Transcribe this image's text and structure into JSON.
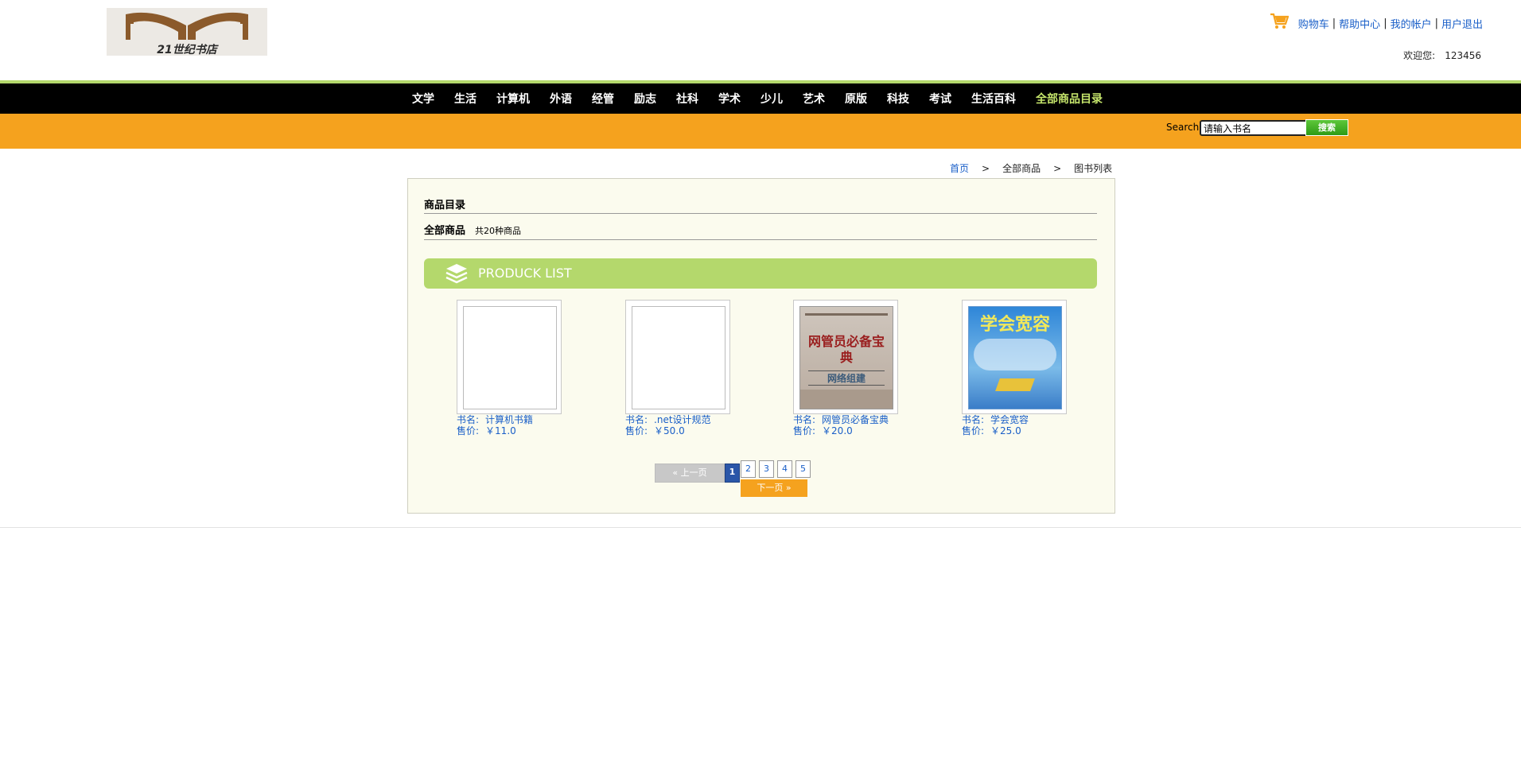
{
  "logo": {
    "text": "21世纪书店"
  },
  "toplinks": {
    "icon": "cart-icon",
    "items": [
      "购物车",
      "帮助中心",
      "我的帐户",
      "用户退出"
    ],
    "separator": "|"
  },
  "welcome": {
    "label": "欢迎您:",
    "user": "123456"
  },
  "nav": {
    "items": [
      "文学",
      "生活",
      "计算机",
      "外语",
      "经管",
      "励志",
      "社科",
      "学术",
      "少儿",
      "艺术",
      "原版",
      "科技",
      "考试",
      "生活百科",
      "全部商品目录"
    ]
  },
  "search": {
    "label": "Search",
    "value": "请输入书名",
    "button": "搜索"
  },
  "breadcrumb": {
    "home": "首页",
    "sep": ">",
    "level2": "全部商品",
    "level3": "图书列表"
  },
  "panel": {
    "title": "商品目录",
    "category": "全部商品",
    "count": "共20种商品",
    "banner": "PRODUCK LIST"
  },
  "products": [
    {
      "name_label": "书名:",
      "name": "计算机书籍",
      "price_label": "售价:",
      "price": "￥11.0"
    },
    {
      "name_label": "书名:",
      "name": ".net设计规范",
      "price_label": "售价:",
      "price": "￥50.0"
    },
    {
      "name_label": "书名:",
      "name": "网管员必备宝典",
      "price_label": "售价:",
      "price": "￥20.0",
      "cover_title": "网管员必备宝典",
      "cover_sub": "网络组建"
    },
    {
      "name_label": "书名:",
      "name": "学会宽容",
      "price_label": "售价:",
      "price": "￥25.0",
      "cover_title": "学会宽容"
    }
  ],
  "pager": {
    "prev": "上一页",
    "next": "下一页",
    "pages": [
      "1",
      "2",
      "3",
      "4",
      "5"
    ],
    "current": "1"
  },
  "colors": {
    "nav_bg": "#000000",
    "nav_highlight": "#c5e56b",
    "search_bar": "#f5a21e",
    "banner": "#b4d86c",
    "link": "#1a5fc8",
    "panel_bg": "#fbfbee"
  }
}
